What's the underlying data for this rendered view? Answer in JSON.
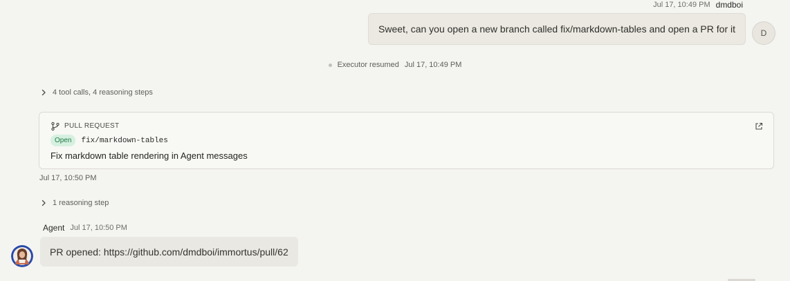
{
  "user_message": {
    "timestamp": "Jul 17, 10:49 PM",
    "author": "dmdboi",
    "text": "Sweet, can you open a new branch called fix/markdown-tables and open a PR for it",
    "avatar_initial": "D"
  },
  "system_event": {
    "label": "Executor resumed",
    "timestamp": "Jul 17, 10:49 PM"
  },
  "collapsible_1": {
    "label": "4 tool calls, 4 reasoning steps"
  },
  "pr_card": {
    "header": "PULL REQUEST",
    "status": "Open",
    "branch": "fix/markdown-tables",
    "title": "Fix markdown table rendering in Agent messages",
    "timestamp": "Jul 17, 10:50 PM",
    "status_color": "#1f7a45",
    "status_bg": "#d6f0e0",
    "icons": {
      "header": "git-branch-icon",
      "action": "external-link-icon"
    }
  },
  "collapsible_2": {
    "label": "1 reasoning step"
  },
  "agent_message": {
    "author": "Agent",
    "timestamp": "Jul 17, 10:50 PM",
    "text": "PR opened: https://github.com/dmdboi/immortus/pull/62"
  },
  "icons": {
    "collapsible": "chevron-right-icon",
    "agent_avatar": "agent-avatar-icon"
  },
  "colors": {
    "background": "#f4f4f1",
    "user_bubble": "#ebe9e1",
    "agent_bubble": "#e9e8e3",
    "agent_avatar_ring": "#2a4aa8"
  }
}
